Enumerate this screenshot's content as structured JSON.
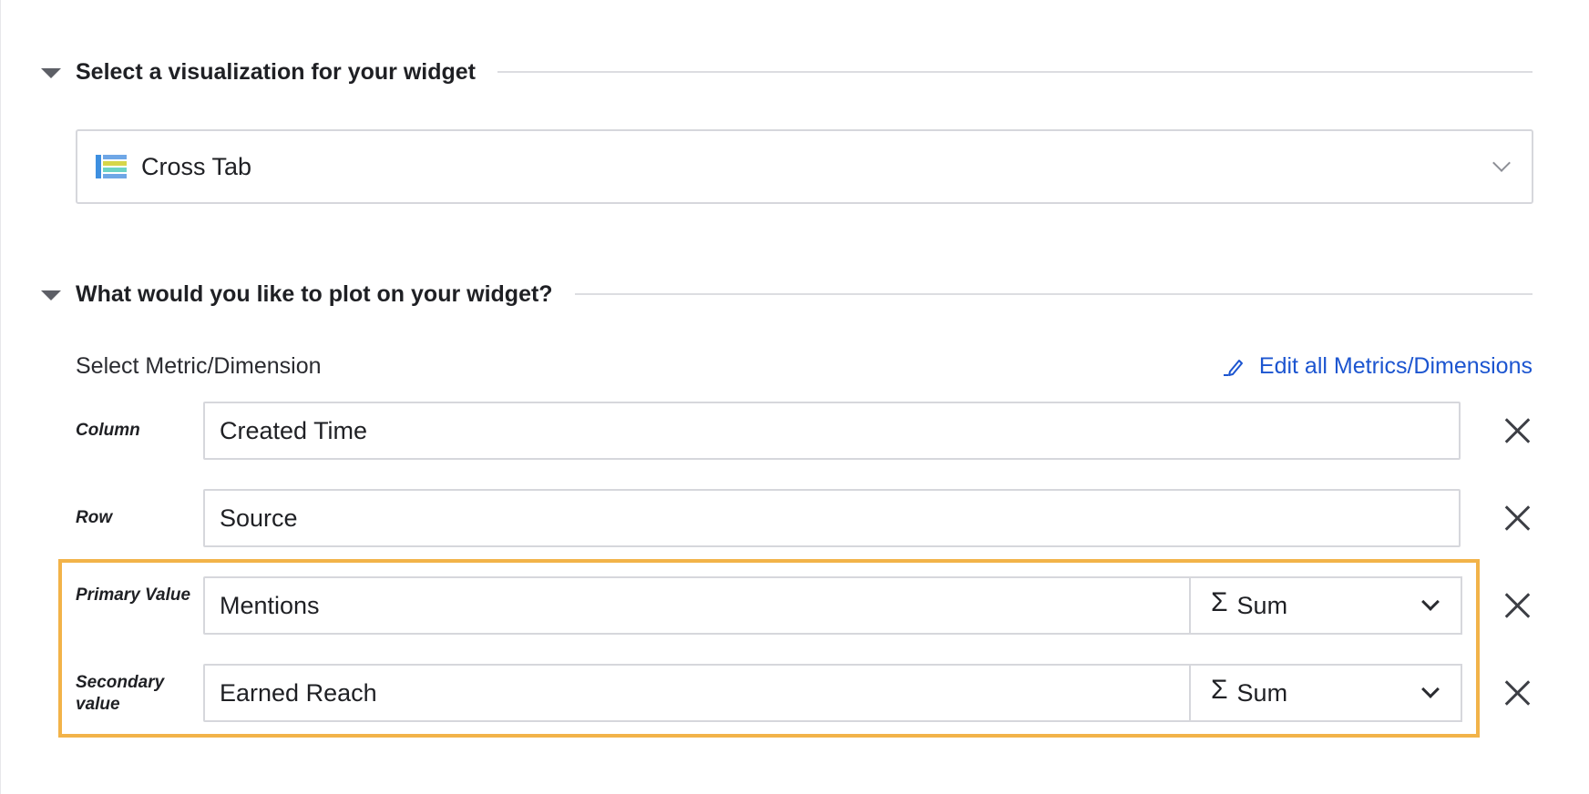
{
  "sections": {
    "visualization": {
      "title": "Select a visualization for your widget"
    },
    "plot": {
      "title": "What would you like to plot on your widget?"
    }
  },
  "visualization_select": {
    "value": "Cross Tab",
    "icon": "cross-tab-icon"
  },
  "metrics": {
    "label": "Select Metric/Dimension",
    "edit_link": "Edit all Metrics/Dimensions",
    "rows": [
      {
        "label": "Column",
        "value": "Created Time"
      },
      {
        "label": "Row",
        "value": "Source"
      },
      {
        "label": "Primary Value",
        "value": "Mentions",
        "aggregation": "Sum"
      },
      {
        "label": "Secondary value",
        "value": "Earned Reach",
        "aggregation": "Sum"
      }
    ]
  },
  "icons": {
    "sigma": "Σ"
  },
  "colors": {
    "accent_link": "#1c55d0",
    "highlight_border": "#f2b349",
    "icon_blue": "#3d8fe0",
    "icon_yellow": "#d7d64a",
    "icon_teal": "#6dd3c6"
  }
}
